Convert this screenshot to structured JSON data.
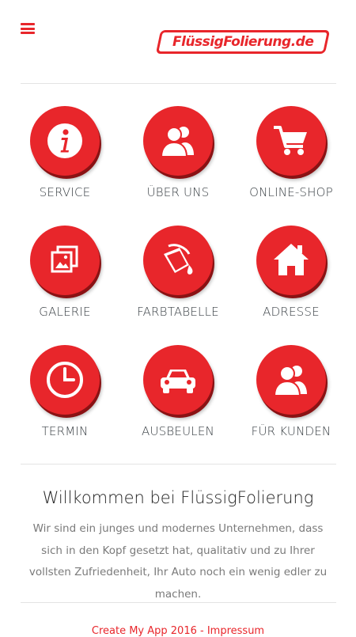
{
  "header": {
    "logo_text": "FlüssigFolierung.de"
  },
  "tiles": [
    {
      "label": "SERVICE",
      "icon": "info-icon"
    },
    {
      "label": "ÜBER UNS",
      "icon": "users-icon"
    },
    {
      "label": "ONLINE-SHOP",
      "icon": "cart-icon"
    },
    {
      "label": "GALERIE",
      "icon": "gallery-icon"
    },
    {
      "label": "FARBTABELLE",
      "icon": "paint-bucket-icon"
    },
    {
      "label": "ADRESSE",
      "icon": "house-icon"
    },
    {
      "label": "TERMIN",
      "icon": "clock-icon"
    },
    {
      "label": "AUSBEULEN",
      "icon": "car-icon"
    },
    {
      "label": "FÜR KUNDEN",
      "icon": "users-icon"
    }
  ],
  "welcome": {
    "title": "Willkommen bei FlüssigFolierung",
    "text": "Wir sind ein junges und modernes Unternehmen, dass sich in den Kopf gesetzt hat, qualitativ und zu Ihrer vollsten Zufriedenheit, Ihr Auto noch ein wenig edler zu machen."
  },
  "footer": {
    "credit": "Create My App 2016",
    "separator": " - ",
    "imprint": "Impressum"
  },
  "colors": {
    "accent": "#e8262b",
    "accent_shadow": "#8a1214"
  }
}
